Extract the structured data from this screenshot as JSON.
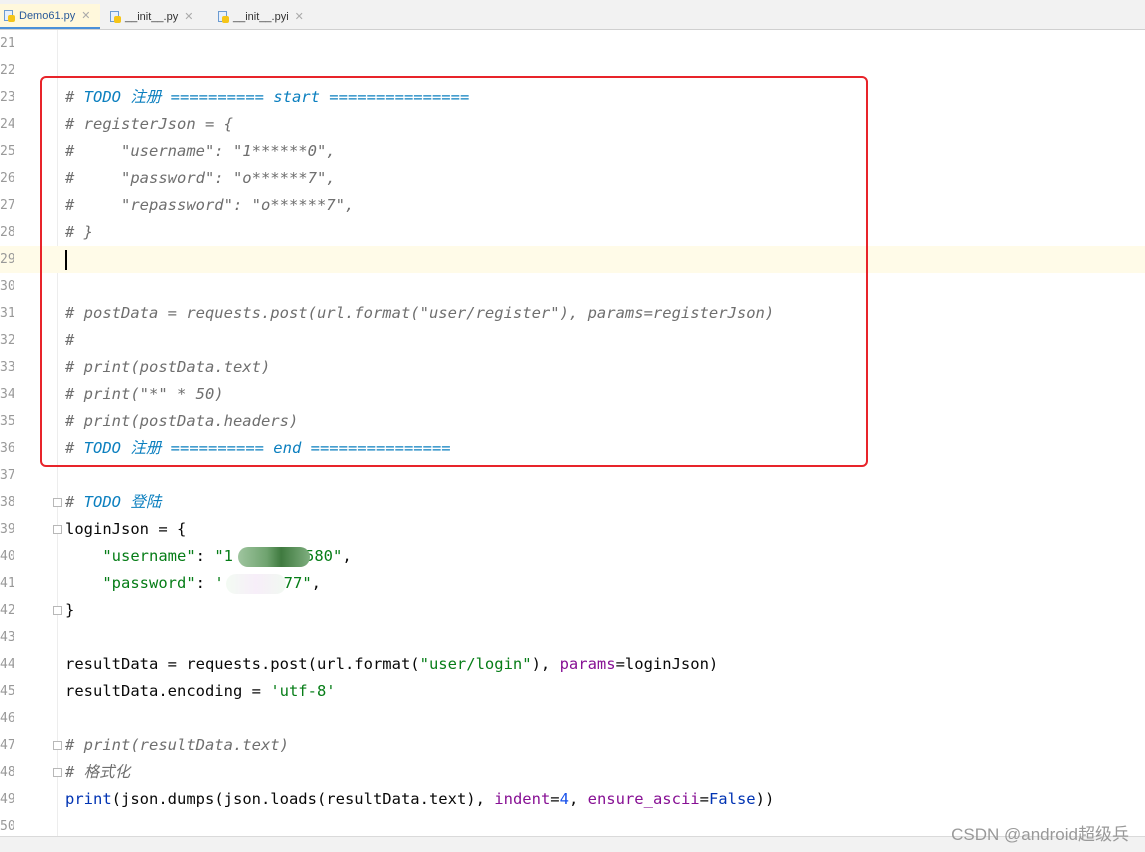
{
  "tabs": [
    {
      "label": "Demo61.py",
      "active": true
    },
    {
      "label": "__init__.py",
      "active": false
    },
    {
      "label": "__init__.pyi",
      "active": false
    }
  ],
  "line_numbers": [
    "21",
    "22",
    "23",
    "24",
    "25",
    "26",
    "27",
    "28",
    "29",
    "30",
    "31",
    "32",
    "33",
    "34",
    "35",
    "36",
    "37",
    "38",
    "39",
    "40",
    "41",
    "42",
    "43",
    "44",
    "45",
    "46",
    "47",
    "48",
    "49",
    "50"
  ],
  "code": {
    "l23": {
      "hash": "# ",
      "todo": "TODO 注册 ========== start ==============="
    },
    "l24": "# registerJson = {",
    "l25": "#     \"username\": \"1******0\",",
    "l26": "#     \"password\": \"o******7\",",
    "l27": "#     \"repassword\": \"o******7\",",
    "l28": "# }",
    "l31": "# postData = requests.post(url.format(\"user/register\"), params=registerJson)",
    "l32": "#",
    "l33": "# print(postData.text)",
    "l34": "# print(\"*\" * 50)",
    "l35": "# print(postData.headers)",
    "l36": {
      "hash": "# ",
      "todo": "TODO 注册 ========== end ==============="
    },
    "l38": {
      "hash": "# ",
      "todo": "TODO 登陆"
    },
    "l39": "loginJson = {",
    "l40": {
      "indent": "    ",
      "key": "\"username\"",
      "sep": ": ",
      "val_start": "\"1",
      "val_end": "580\"",
      "tail": ","
    },
    "l41": {
      "indent": "    ",
      "key": "\"password\"",
      "sep": ": ",
      "val_start": "'",
      "val_end": "77\"",
      "tail": ","
    },
    "l42": "}",
    "l44": {
      "a": "resultData = requests.post(url.format(",
      "s": "\"user/login\"",
      "b": "), ",
      "p": "params",
      "c": "=loginJson)"
    },
    "l45": {
      "a": "resultData.encoding = ",
      "s": "'utf-8'"
    },
    "l47": "# print(resultData.text)",
    "l48": "# 格式化",
    "l49": {
      "f": "print",
      "a": "(json.dumps(json.loads(resultData.text), ",
      "p1": "indent",
      "eq1": "=",
      "n": "4",
      "c": ", ",
      "p2": "ensure_ascii",
      "eq2": "=",
      "k": "False",
      "e": "))"
    }
  },
  "colors": {
    "highlight_box": "#e8242a",
    "todo": "#0b7fbf",
    "string": "#067d17",
    "keyword": "#0033b3"
  },
  "watermark": "CSDN @android超级兵"
}
